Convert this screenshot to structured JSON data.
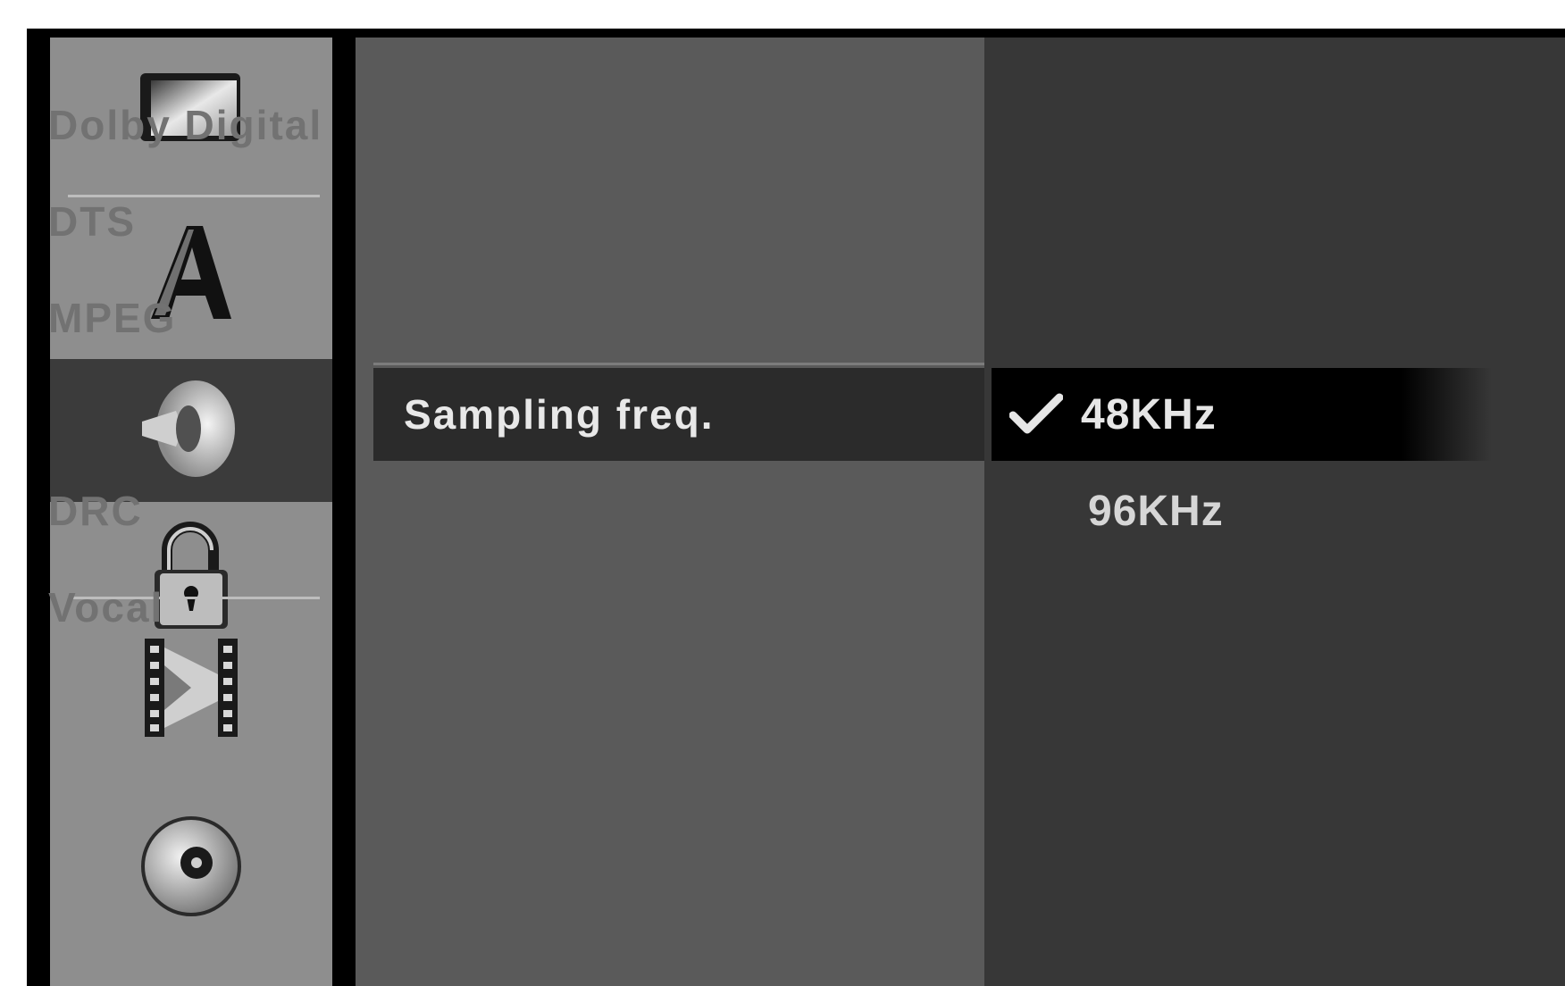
{
  "sidebar": {
    "items": [
      {
        "name": "display-icon",
        "active": false
      },
      {
        "name": "language-icon",
        "glyph": "A",
        "active": false
      },
      {
        "name": "speaker-icon",
        "active": true
      },
      {
        "name": "lock-icon",
        "active": false
      },
      {
        "name": "film-icon",
        "active": false
      },
      {
        "name": "disc-icon",
        "active": false
      }
    ]
  },
  "menu": {
    "items": [
      {
        "label": "Dolby Digital"
      },
      {
        "label": "DTS"
      },
      {
        "label": "MPEG"
      },
      {
        "label": "Sampling freq.",
        "selected": true
      },
      {
        "label": "DRC"
      },
      {
        "label": "Vocal"
      }
    ]
  },
  "options": {
    "items": [
      {
        "label": "48KHz",
        "checked": true,
        "check_icon": "checkmark-icon"
      },
      {
        "label": "96KHz",
        "checked": false
      }
    ]
  },
  "colors": {
    "sidebar_bg": "#8e8e8e",
    "sidebar_active": "#3b3b3b",
    "menu_bg": "#5a5a5a",
    "value_bg": "#373737",
    "selected_bg": "#2b2b2b",
    "inactive_text": "#727272",
    "active_text": "#e8e8e8"
  }
}
